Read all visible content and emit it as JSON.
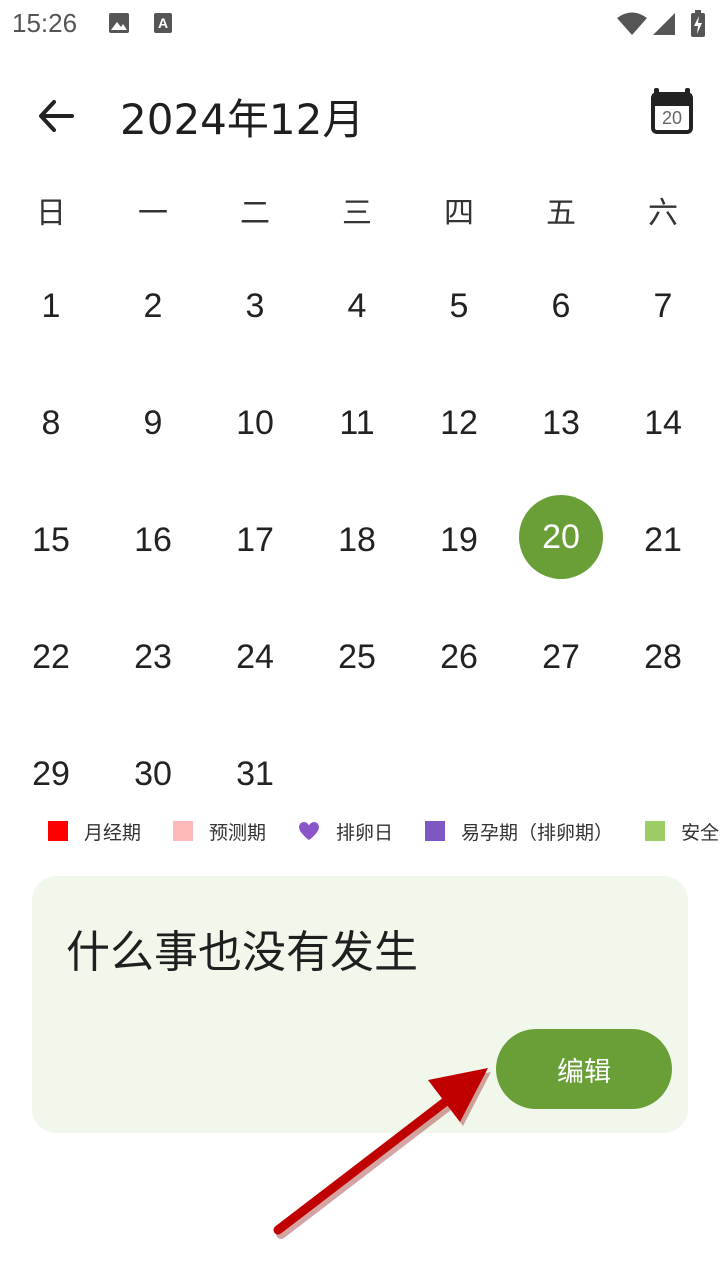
{
  "status_bar": {
    "time": "15:26",
    "icons": [
      "image-icon",
      "keyboard-a-icon",
      "wifi-icon",
      "signal-icon",
      "battery-charging-icon"
    ]
  },
  "header": {
    "title": "2024年12月",
    "today_number": "20"
  },
  "weekdays": [
    "日",
    "一",
    "二",
    "三",
    "四",
    "五",
    "六"
  ],
  "calendar": {
    "selected_day": "20",
    "weeks": [
      [
        "1",
        "2",
        "3",
        "4",
        "5",
        "6",
        "7"
      ],
      [
        "8",
        "9",
        "10",
        "11",
        "12",
        "13",
        "14"
      ],
      [
        "15",
        "16",
        "17",
        "18",
        "19",
        "20",
        "21"
      ],
      [
        "22",
        "23",
        "24",
        "25",
        "26",
        "27",
        "28"
      ],
      [
        "29",
        "30",
        "31",
        "",
        "",
        "",
        ""
      ]
    ]
  },
  "legend": [
    {
      "label": "月经期",
      "color": "#ff0000",
      "shape": "square"
    },
    {
      "label": "预测期",
      "color": "#ffb8b8",
      "shape": "square"
    },
    {
      "label": "排卵日",
      "color": "#8a55c8",
      "shape": "heart"
    },
    {
      "label": "易孕期（排卵期）",
      "color": "#7e57c2",
      "shape": "square"
    },
    {
      "label": "安全期",
      "color": "#9ccc65",
      "shape": "square"
    }
  ],
  "event_card": {
    "text": "什么事也没有发生",
    "edit_label": "编辑"
  },
  "colors": {
    "accent": "#6a9e36",
    "card_bg": "#f2f7ec",
    "annotation_arrow": "#c00000"
  }
}
